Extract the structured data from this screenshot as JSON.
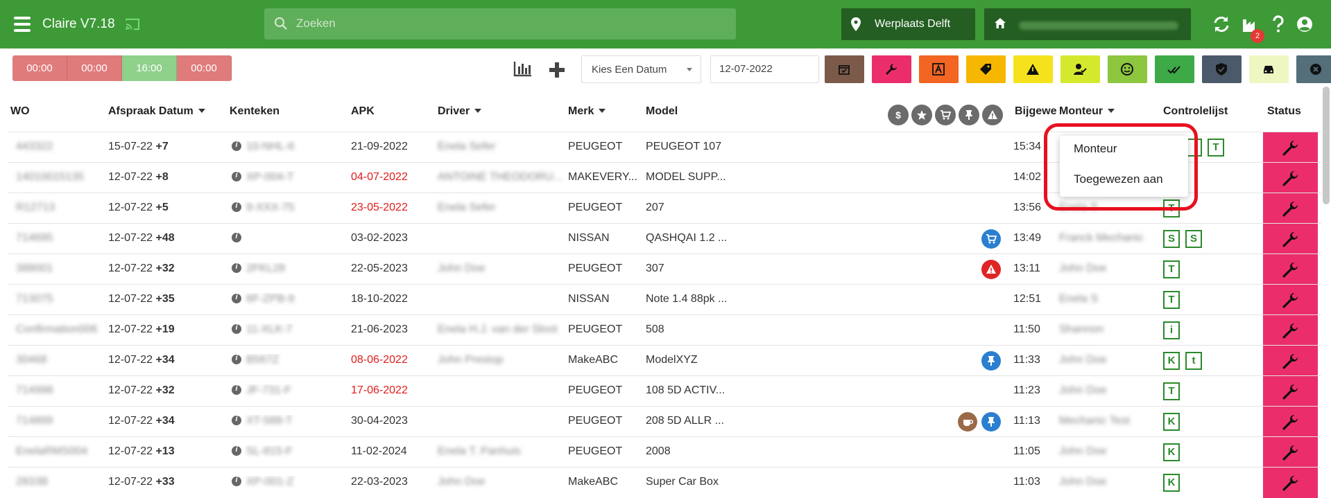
{
  "app": {
    "title": "Claire V7.18"
  },
  "search": {
    "placeholder": "Zoeken"
  },
  "location": {
    "label": "Werplaats Delft"
  },
  "notifications": {
    "count": "2"
  },
  "timers": [
    "00:00",
    "00:00",
    "16:00",
    "00:00"
  ],
  "date_filter": {
    "select_label": "Kies Een Datum",
    "date_value": "12-07-2022"
  },
  "filter_colors": [
    "#7b5a4a",
    "#ec2d6c",
    "#f26522",
    "#f5b700",
    "#f6e21c",
    "#d4e92e",
    "#8dc63f",
    "#3daa47",
    "#4a5a6a",
    "#eef6c2",
    "#546e7a"
  ],
  "columns": {
    "wo": "WO",
    "afspraak": "Afspraak Datum",
    "kenteken": "Kenteken",
    "apk": "APK",
    "driver": "Driver",
    "merk": "Merk",
    "model": "Model",
    "bijgewerkt": "Bijgewe",
    "monteur": "Monteur",
    "controlelijst": "Controlelijst",
    "status": "Status"
  },
  "dropdown": {
    "options": [
      "Monteur",
      "Toegewezen aan"
    ]
  },
  "rows": [
    {
      "wo": "443322",
      "date": "15-07-22",
      "plus": "+7",
      "kenteken": "10-NHL-6",
      "apk": "21-09-2022",
      "apk_red": false,
      "driver": "Enela Sefer",
      "merk": "PEUGEOT",
      "model": "PEUGEOT 107",
      "time": "15:34",
      "monteur": "",
      "chips": [
        "",
        "",
        "T"
      ]
    },
    {
      "wo": "14010015135",
      "date": "12-07-22",
      "plus": "+8",
      "kenteken": "XP-004-T",
      "apk": "04-07-2022",
      "apk_red": true,
      "driver": "ANTOINE THEODORU...",
      "merk": "MAKEVERY...",
      "model": "MODEL SUPP...",
      "time": "14:02",
      "monteur": "",
      "chips": [
        ""
      ]
    },
    {
      "wo": "R12713",
      "date": "12-07-22",
      "plus": "+5",
      "kenteken": "9-XXX-75",
      "apk": "23-05-2022",
      "apk_red": true,
      "driver": "Enela Sefer",
      "merk": "PEUGEOT",
      "model": "207",
      "time": "13:56",
      "monteur": "Enela S",
      "chips": [
        "T"
      ]
    },
    {
      "wo": "714695",
      "date": "12-07-22",
      "plus": "+48",
      "kenteken": "",
      "apk": "03-02-2023",
      "apk_red": false,
      "driver": "",
      "merk": "NISSAN",
      "model": "QASHQAI 1.2 ...",
      "time": "13:49",
      "monteur": "Franck Mechanic",
      "chips": [
        "S",
        "S"
      ],
      "icons": [
        "cart-icon"
      ]
    },
    {
      "wo": "388001",
      "date": "12-07-22",
      "plus": "+32",
      "kenteken": "2FKL28",
      "apk": "22-05-2023",
      "apk_red": false,
      "driver": "John Doe",
      "merk": "PEUGEOT",
      "model": "307",
      "time": "13:11",
      "monteur": "John Doe",
      "chips": [
        "T"
      ],
      "icons": [
        "warning-icon"
      ]
    },
    {
      "wo": "713075",
      "date": "12-07-22",
      "plus": "+35",
      "kenteken": "6F-ZPB-9",
      "apk": "18-10-2022",
      "apk_red": false,
      "driver": "",
      "merk": "NISSAN",
      "model": "Note 1.4 88pk ...",
      "time": "12:51",
      "monteur": "Enela S",
      "chips": [
        "T"
      ]
    },
    {
      "wo": "Confirmation006",
      "date": "12-07-22",
      "plus": "+19",
      "kenteken": "11-XLK-7",
      "apk": "21-06-2023",
      "apk_red": false,
      "driver": "Enela H.J. van der Sloot",
      "merk": "PEUGEOT",
      "model": "508",
      "time": "11:50",
      "monteur": "Shannon",
      "chips": [
        "i"
      ]
    },
    {
      "wo": "30468",
      "date": "12-07-22",
      "plus": "+34",
      "kenteken": "B567Z",
      "apk": "08-06-2022",
      "apk_red": true,
      "driver": "John Prestop",
      "merk": "MakeABC",
      "model": "ModelXYZ",
      "time": "11:33",
      "monteur": "John Doe",
      "chips": [
        "K",
        "t"
      ],
      "icons": [
        "pin-icon"
      ]
    },
    {
      "wo": "714998",
      "date": "12-07-22",
      "plus": "+32",
      "kenteken": "JF-731-F",
      "apk": "17-06-2022",
      "apk_red": true,
      "driver": "",
      "merk": "PEUGEOT",
      "model": "108 5D ACTIV...",
      "time": "11:23",
      "monteur": "John Doe",
      "chips": [
        "T"
      ]
    },
    {
      "wo": "714899",
      "date": "12-07-22",
      "plus": "+34",
      "kenteken": "XT-588-T",
      "apk": "30-04-2023",
      "apk_red": false,
      "driver": "",
      "merk": "PEUGEOT",
      "model": "208 5D ALLR ...",
      "time": "11:13",
      "monteur": "Mechanic Test",
      "chips": [
        "K"
      ],
      "icons": [
        "coffee-icon",
        "pin-icon"
      ]
    },
    {
      "wo": "EnelaRMS004",
      "date": "12-07-22",
      "plus": "+13",
      "kenteken": "SL-815-F",
      "apk": "11-02-2024",
      "apk_red": false,
      "driver": "Enela T. Panhuis",
      "merk": "PEUGEOT",
      "model": "2008",
      "time": "11:05",
      "monteur": "John Doe",
      "chips": [
        "K"
      ]
    },
    {
      "wo": "2833B",
      "date": "12-07-22",
      "plus": "+33",
      "kenteken": "XP-001-Z",
      "apk": "22-03-2023",
      "apk_red": false,
      "driver": "John Doe",
      "merk": "MakeABC",
      "model": "Super Car Box",
      "time": "11:03",
      "monteur": "John Doe",
      "chips": [
        "K"
      ]
    }
  ]
}
